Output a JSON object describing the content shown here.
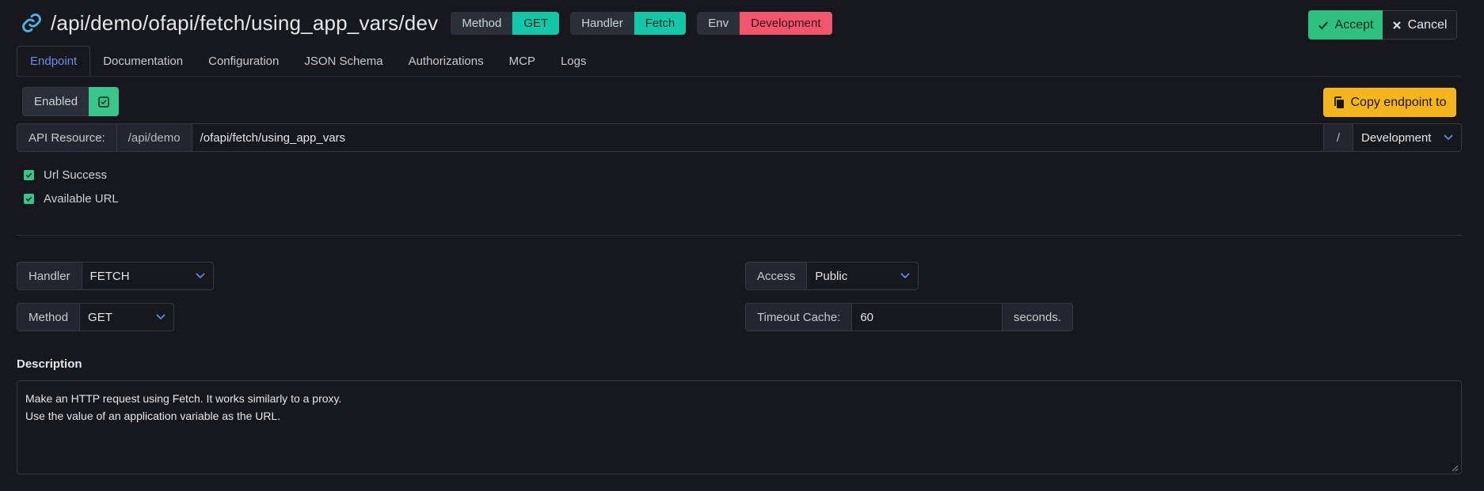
{
  "header": {
    "path": "/api/demo/ofapi/fetch/using_app_vars/dev",
    "badges": [
      {
        "key": "Method",
        "value": "GET"
      },
      {
        "key": "Handler",
        "value": "Fetch"
      },
      {
        "key": "Env",
        "value": "Development"
      }
    ],
    "accept_label": "Accept",
    "cancel_label": "Cancel"
  },
  "tabs": [
    "Endpoint",
    "Documentation",
    "Configuration",
    "JSON Schema",
    "Authorizations",
    "MCP",
    "Logs"
  ],
  "active_tab": "Endpoint",
  "enabled": {
    "label": "Enabled",
    "checked": true
  },
  "copy_button_label": "Copy endpoint to",
  "api_resource": {
    "label": "API Resource:",
    "prefix": "/api/demo",
    "path": "/ofapi/fetch/using_app_vars",
    "separator": "/",
    "environment": "Development"
  },
  "checks": [
    {
      "label": "Url Success",
      "checked": true
    },
    {
      "label": "Available URL",
      "checked": true
    }
  ],
  "handler": {
    "label": "Handler",
    "value": "FETCH"
  },
  "method": {
    "label": "Method",
    "value": "GET"
  },
  "access": {
    "label": "Access",
    "value": "Public"
  },
  "timeout": {
    "label": "Timeout Cache:",
    "value": "60",
    "suffix": "seconds."
  },
  "description": {
    "label": "Description",
    "lines": [
      "Make an HTTP request using Fetch. It works similarly to a proxy.",
      "Use the value of an application variable as the URL."
    ]
  },
  "colors": {
    "background": "#16181d",
    "teal": "#14c7a8",
    "red": "#f2566f",
    "green": "#2fbf7f",
    "yellow": "#f5b51c",
    "tab_active": "#6d8df0"
  }
}
